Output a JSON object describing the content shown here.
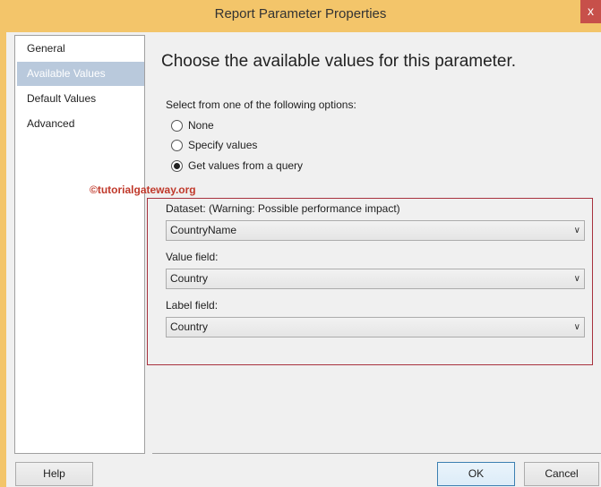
{
  "window": {
    "title": "Report Parameter Properties",
    "close_label": "x"
  },
  "sidebar": {
    "items": [
      {
        "label": "General"
      },
      {
        "label": "Available Values"
      },
      {
        "label": "Default Values"
      },
      {
        "label": "Advanced"
      }
    ]
  },
  "main": {
    "heading": "Choose the available values for this parameter.",
    "prompt": "Select from one of the following options:",
    "options": [
      {
        "label": "None"
      },
      {
        "label": "Specify values"
      },
      {
        "label": "Get values from a query"
      }
    ],
    "watermark": "©tutorialgateway.org",
    "dataset_label": "Dataset: (Warning: Possible performance impact)",
    "dataset_value": "CountryName",
    "value_field_label": "Value field:",
    "value_field_value": "Country",
    "label_field_label": "Label field:",
    "label_field_value": "Country"
  },
  "buttons": {
    "help": "Help",
    "ok": "OK",
    "cancel": "Cancel"
  }
}
